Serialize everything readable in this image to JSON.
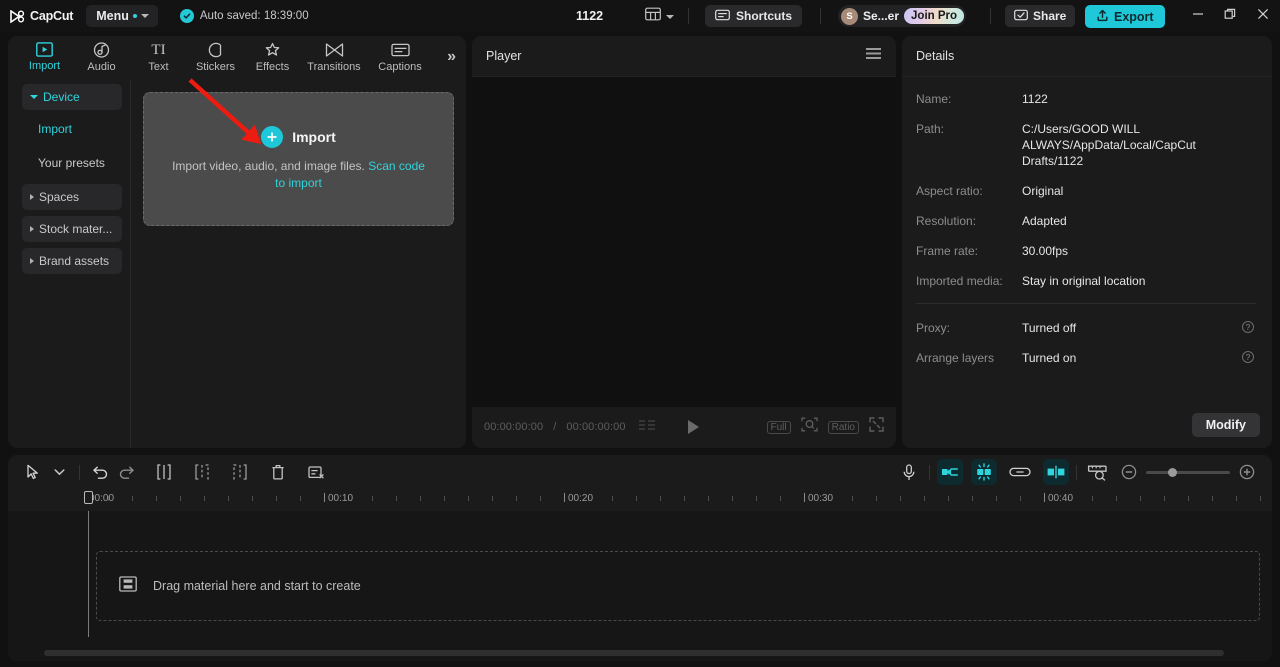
{
  "titlebar": {
    "brand": "CapCut",
    "menu_label": "Menu",
    "autosave_text": "Auto saved: 18:39:00",
    "doc_title": "1122",
    "shortcuts_label": "Shortcuts",
    "account_initial": "S",
    "account_name": "Se...er",
    "join_pro_label": "Join Pro",
    "share_label": "Share",
    "export_label": "Export",
    "icons": {
      "layout": "layout-grid-icon",
      "layout_caret": "chevron-down-icon",
      "shortcuts": "keyboard-icon",
      "share": "share-box-icon",
      "export": "upload-icon",
      "minimize": "minimize-icon",
      "maximize": "maximize-icon",
      "close": "close-icon"
    },
    "accent": "#1ec8d8"
  },
  "left_panel": {
    "tabs": [
      {
        "label": "Import",
        "icon": "import-media-icon",
        "active": true
      },
      {
        "label": "Audio",
        "icon": "audio-note-icon",
        "active": false
      },
      {
        "label": "Text",
        "icon": "text-ti-icon",
        "active": false
      },
      {
        "label": "Stickers",
        "icon": "sticker-circle-icon",
        "active": false
      },
      {
        "label": "Effects",
        "icon": "effects-sparkle-icon",
        "active": false
      },
      {
        "label": "Transitions",
        "icon": "transitions-bowtie-icon",
        "active": false
      },
      {
        "label": "Captions",
        "icon": "captions-box-icon",
        "active": false
      }
    ],
    "more_label": "»",
    "nav": [
      {
        "label": "Device",
        "type": "group",
        "expanded": true,
        "active": true
      },
      {
        "label": "Import",
        "type": "sub",
        "active": true
      },
      {
        "label": "Your presets",
        "type": "sub",
        "active": false
      },
      {
        "label": "Spaces",
        "type": "group",
        "expanded": false,
        "active": false
      },
      {
        "label": "Stock mater...",
        "type": "group",
        "expanded": false,
        "active": false
      },
      {
        "label": "Brand assets",
        "type": "group",
        "expanded": false,
        "active": false
      }
    ],
    "dropzone": {
      "title": "Import",
      "plus_icon": "plus-icon",
      "description": "Import video, audio, and image files.",
      "link_text": "Scan code to import"
    },
    "annotation": {
      "type": "arrow",
      "color": "#ee1b11"
    }
  },
  "player": {
    "title": "Player",
    "menu_icon": "hamburger-menu-icon",
    "current_time": "00:00:00:00",
    "total_time": "00:00:00:00",
    "time_separator": "/",
    "play_icon": "play-icon",
    "controls": [
      {
        "label": "Full",
        "name": "full-quality-chip"
      },
      {
        "label": "",
        "name": "magnifier-icon"
      },
      {
        "label": "Ratio",
        "name": "ratio-chip"
      },
      {
        "label": "",
        "name": "fullscreen-icon"
      }
    ]
  },
  "details": {
    "title": "Details",
    "rows": [
      {
        "key": "Name:",
        "value": "1122",
        "help": false
      },
      {
        "key": "Path:",
        "value": "C:/Users/GOOD WILL ALWAYS/AppData/Local/CapCut Drafts/1122",
        "help": false
      },
      {
        "key": "Aspect ratio:",
        "value": "Original",
        "help": false
      },
      {
        "key": "Resolution:",
        "value": "Adapted",
        "help": false
      },
      {
        "key": "Frame rate:",
        "value": "30.00fps",
        "help": false
      },
      {
        "key": "Imported media:",
        "value": "Stay in original location",
        "help": false
      }
    ],
    "rows2": [
      {
        "key": "Proxy:",
        "value": "Turned off",
        "help": true
      },
      {
        "key": "Arrange layers",
        "value": "Turned on",
        "help": true
      }
    ],
    "modify_label": "Modify",
    "help_glyph": "?"
  },
  "timeline": {
    "tools_left": [
      {
        "name": "select-cursor-icon",
        "active": false
      },
      {
        "name": "cursor-dropdown-icon",
        "active": false
      },
      {
        "name": "undo-icon",
        "active": false
      },
      {
        "name": "redo-icon",
        "active": false
      },
      {
        "name": "split-icon",
        "active": false
      },
      {
        "name": "trim-left-icon",
        "active": false
      },
      {
        "name": "trim-right-icon",
        "active": false
      },
      {
        "name": "delete-icon",
        "active": false
      },
      {
        "name": "crop-remove-icon",
        "active": false
      }
    ],
    "tools_right": [
      {
        "name": "microphone-icon",
        "active": false
      },
      {
        "name": "mirror-clip-icon",
        "active": true
      },
      {
        "name": "auto-adjust-icon",
        "active": true
      },
      {
        "name": "link-icon",
        "active": false
      },
      {
        "name": "snap-align-icon",
        "active": true
      },
      {
        "name": "preview-scale-icon",
        "active": false
      },
      {
        "name": "zoom-out-icon",
        "active": false
      },
      {
        "name": "zoom-slider",
        "active": true
      },
      {
        "name": "zoom-in-icon",
        "active": false
      }
    ],
    "ruler_labels": [
      "00:00",
      "00:10",
      "00:20",
      "00:30",
      "00:40"
    ],
    "ruler_label_x": [
      84,
      324,
      563,
      803,
      1042
    ],
    "minor_tick_spacing": 24,
    "track_placeholder": "Drag material here and start to create",
    "track_icon": "film-strip-icon"
  }
}
